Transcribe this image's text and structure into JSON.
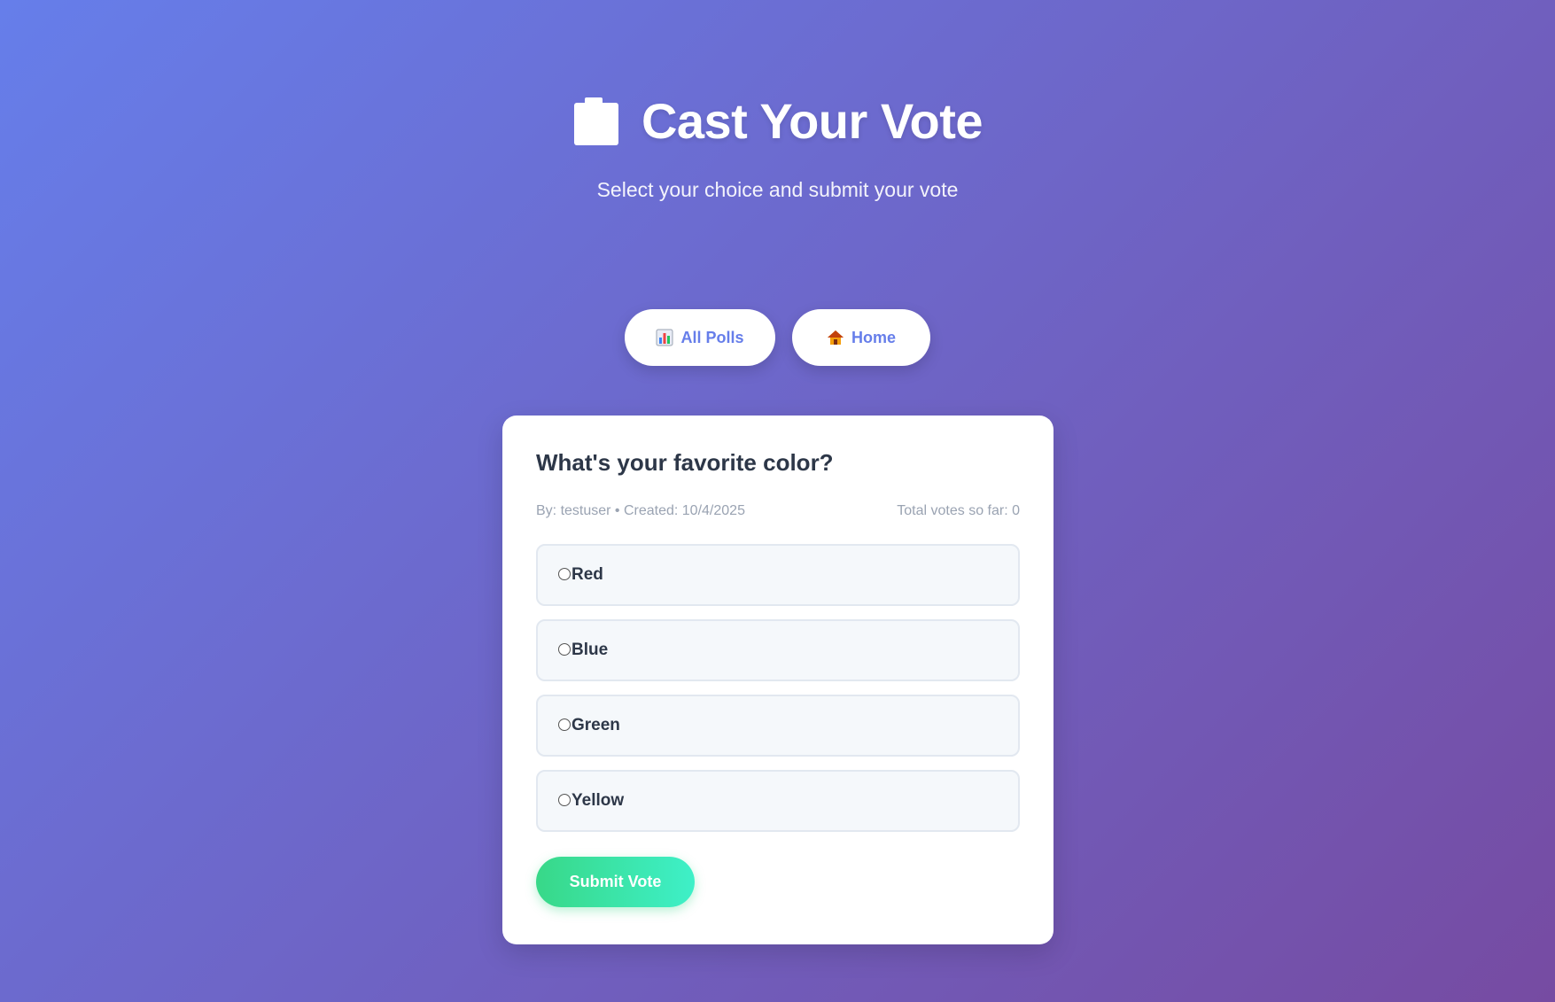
{
  "header": {
    "title": "Cast Your Vote",
    "icon": "clipboard-icon",
    "subtitle": "Select your choice and submit your vote"
  },
  "nav": {
    "all_polls": {
      "label": "All Polls",
      "icon": "bar-chart-icon"
    },
    "home": {
      "label": "Home",
      "icon": "house-icon"
    }
  },
  "poll": {
    "question": "What's your favorite color?",
    "meta": "By: testuser • Created: 10/4/2025",
    "total_votes": "Total votes so far: 0",
    "options": [
      {
        "label": "Red",
        "selected": false
      },
      {
        "label": "Blue",
        "selected": false
      },
      {
        "label": "Green",
        "selected": false
      },
      {
        "label": "Yellow",
        "selected": false
      }
    ],
    "submit_label": "Submit Vote"
  },
  "colors": {
    "gradient_start": "#667eea",
    "gradient_end": "#764ba2",
    "nav_text": "#667eea",
    "submit_start": "#38d888",
    "submit_end": "#3ef0c8"
  }
}
